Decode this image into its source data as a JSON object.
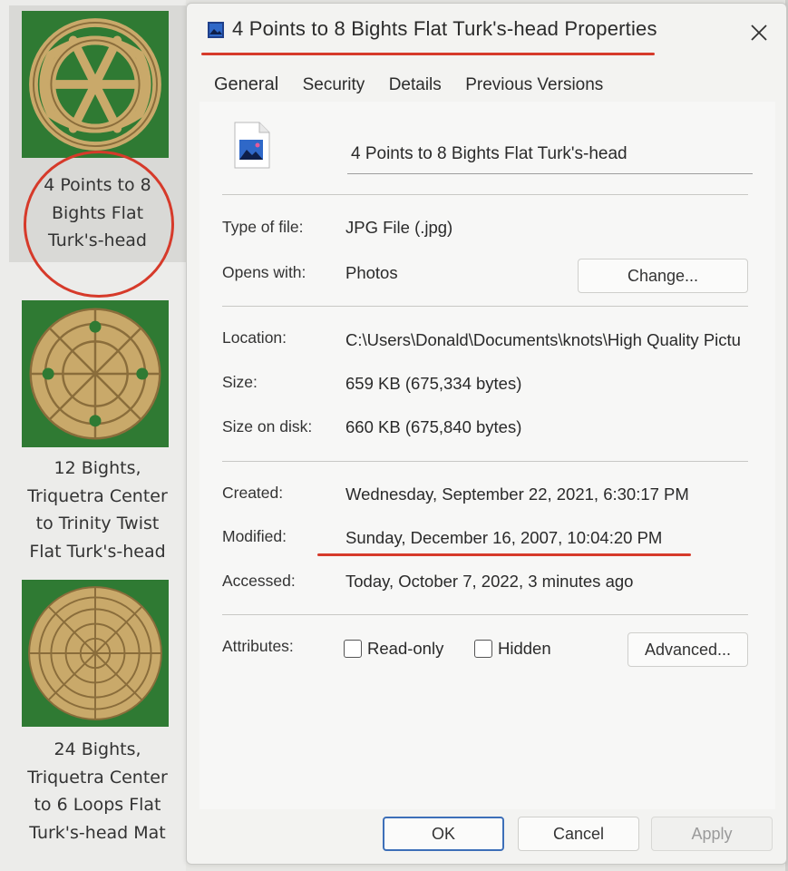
{
  "explorer": {
    "items": [
      {
        "label": "4 Points to 8\nBights Flat\nTurk's-head"
      },
      {
        "label": "12 Bights,\nTriquetra Center\nto Trinity Twist\nFlat Turk's-head"
      },
      {
        "label": "24 Bights,\nTriquetra Center\nto 6 Loops Flat\nTurk's-head Mat"
      }
    ],
    "thumb_bg_color": "#2f7a33",
    "rope_color": "#c9a96a"
  },
  "dialog": {
    "title": "4 Points to 8 Bights Flat Turk's-head Properties",
    "close_icon": "close-icon",
    "tabs": [
      "General",
      "Security",
      "Details",
      "Previous Versions"
    ],
    "general": {
      "file_name": "4 Points to 8 Bights Flat Turk's-head",
      "type_of_file_label": "Type of file:",
      "type_of_file_value": "JPG File (.jpg)",
      "opens_with_label": "Opens with:",
      "opens_with_value": "Photos",
      "change_button": "Change...",
      "location_label": "Location:",
      "location_value": "C:\\Users\\Donald\\Documents\\knots\\High Quality Pictu",
      "size_label": "Size:",
      "size_value": "659 KB (675,334 bytes)",
      "size_on_disk_label": "Size on disk:",
      "size_on_disk_value": "660 KB (675,840 bytes)",
      "created_label": "Created:",
      "created_value": "Wednesday, September 22, 2021, 6:30:17 PM",
      "modified_label": "Modified:",
      "modified_value": "Sunday, December 16, 2007, 10:04:20 PM",
      "accessed_label": "Accessed:",
      "accessed_value": "Today, October 7, 2022, 3 minutes ago",
      "attributes_label": "Attributes:",
      "readonly_label": "Read-only",
      "hidden_label": "Hidden",
      "readonly_checked": false,
      "hidden_checked": false,
      "advanced_button": "Advanced..."
    },
    "footer": {
      "ok": "OK",
      "cancel": "Cancel",
      "apply": "Apply"
    }
  },
  "annotation_color": "#d63a2a",
  "accent_color": "#3d6fb8"
}
